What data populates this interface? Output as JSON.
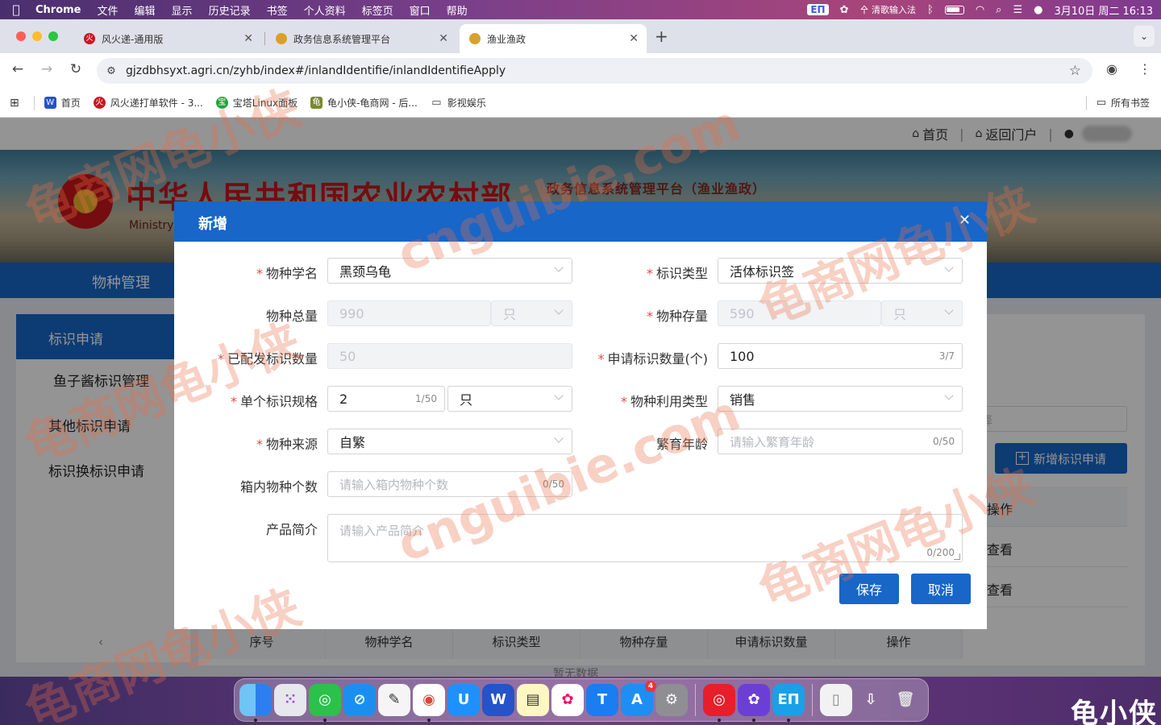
{
  "menubar": {
    "app": "Chrome",
    "items": [
      "文件",
      "编辑",
      "显示",
      "历史记录",
      "书签",
      "个人资料",
      "标签页",
      "窗口",
      "帮助"
    ],
    "ime": "清歌输入法",
    "datetime": "3月10日 周二 16:13"
  },
  "tabs": [
    {
      "title": "风火递-通用版",
      "favicon": "火"
    },
    {
      "title": "政务信息系统管理平台",
      "favicon": ""
    },
    {
      "title": "渔业渔政",
      "favicon": ""
    }
  ],
  "address": {
    "url": "gjzdbhsyxt.agri.cn/zyhb/index#/inlandIdentifie/inlandIdentifieApply"
  },
  "bookmarks": {
    "items": [
      "首页",
      "风火递打单软件 - 3...",
      "宝塔Linux面板",
      "龟小侠-龟商网 - 后...",
      "影视娱乐"
    ],
    "all_label": "所有书签"
  },
  "site": {
    "top_links": {
      "home": "首页",
      "portal": "返回门户"
    },
    "ministry_cn": "中华人民共和国农业农村部",
    "ministry_en": "Ministry o",
    "platform": "政务信息系统管理平台（渔业渔政）",
    "nav_item": "物种管理"
  },
  "sidebar": {
    "active": "标识申请",
    "items": [
      "鱼子酱标识管理",
      "其他标识申请",
      "标识换标识申请"
    ]
  },
  "content": {
    "select_placeholder": "择",
    "add_button": "新增标识申请",
    "op_header": "操作",
    "row_actions": [
      "查看",
      "查看"
    ],
    "table_headers": [
      "序号",
      "物种学名",
      "标识类型",
      "物种存量",
      "申请标识数量",
      "操作"
    ],
    "no_data": "暂无数据"
  },
  "modal": {
    "title": "新增",
    "fields": {
      "species_name": {
        "label": "物种学名",
        "value": "黑颈乌龟"
      },
      "mark_type": {
        "label": "标识类型",
        "value": "活体标识签"
      },
      "species_total": {
        "label": "物种总量",
        "value": "990",
        "unit": "只"
      },
      "species_stock": {
        "label": "物种存量",
        "value": "590",
        "unit": "只"
      },
      "issued_count": {
        "label": "已配发标识数量",
        "value": "50"
      },
      "apply_count": {
        "label": "申请标识数量(个)",
        "value": "100",
        "counter": "3/7"
      },
      "spec": {
        "label": "单个标识规格",
        "value": "2",
        "counter": "1/50",
        "unit": "只"
      },
      "use_type": {
        "label": "物种利用类型",
        "value": "销售"
      },
      "source": {
        "label": "物种来源",
        "value": "自繁"
      },
      "breed_age": {
        "label": "繁育年龄",
        "placeholder": "请输入繁育年龄",
        "counter": "0/50"
      },
      "box_count": {
        "label": "箱内物种个数",
        "placeholder": "请输入箱内物种个数",
        "counter": "0/50"
      },
      "intro": {
        "label": "产品简介",
        "placeholder": "请输入产品简介",
        "counter": "0/200"
      }
    },
    "save_label": "保存",
    "cancel_label": "取消"
  },
  "dock": {
    "items": [
      "Finder",
      "Launchpad",
      "微信",
      "Safari",
      "无边记",
      "Chrome",
      "优酷",
      "风火递",
      "备忘录",
      "照片",
      "Typora",
      "App Store",
      "系统设置",
      "网易云音乐",
      "剪映",
      "清歌输入法",
      "文稿",
      "下载",
      "废纸篓"
    ],
    "appstore_badge": "4"
  },
  "brand": "龟小侠",
  "watermark": [
    "龟商网龟小侠",
    "cnguibie.com"
  ]
}
